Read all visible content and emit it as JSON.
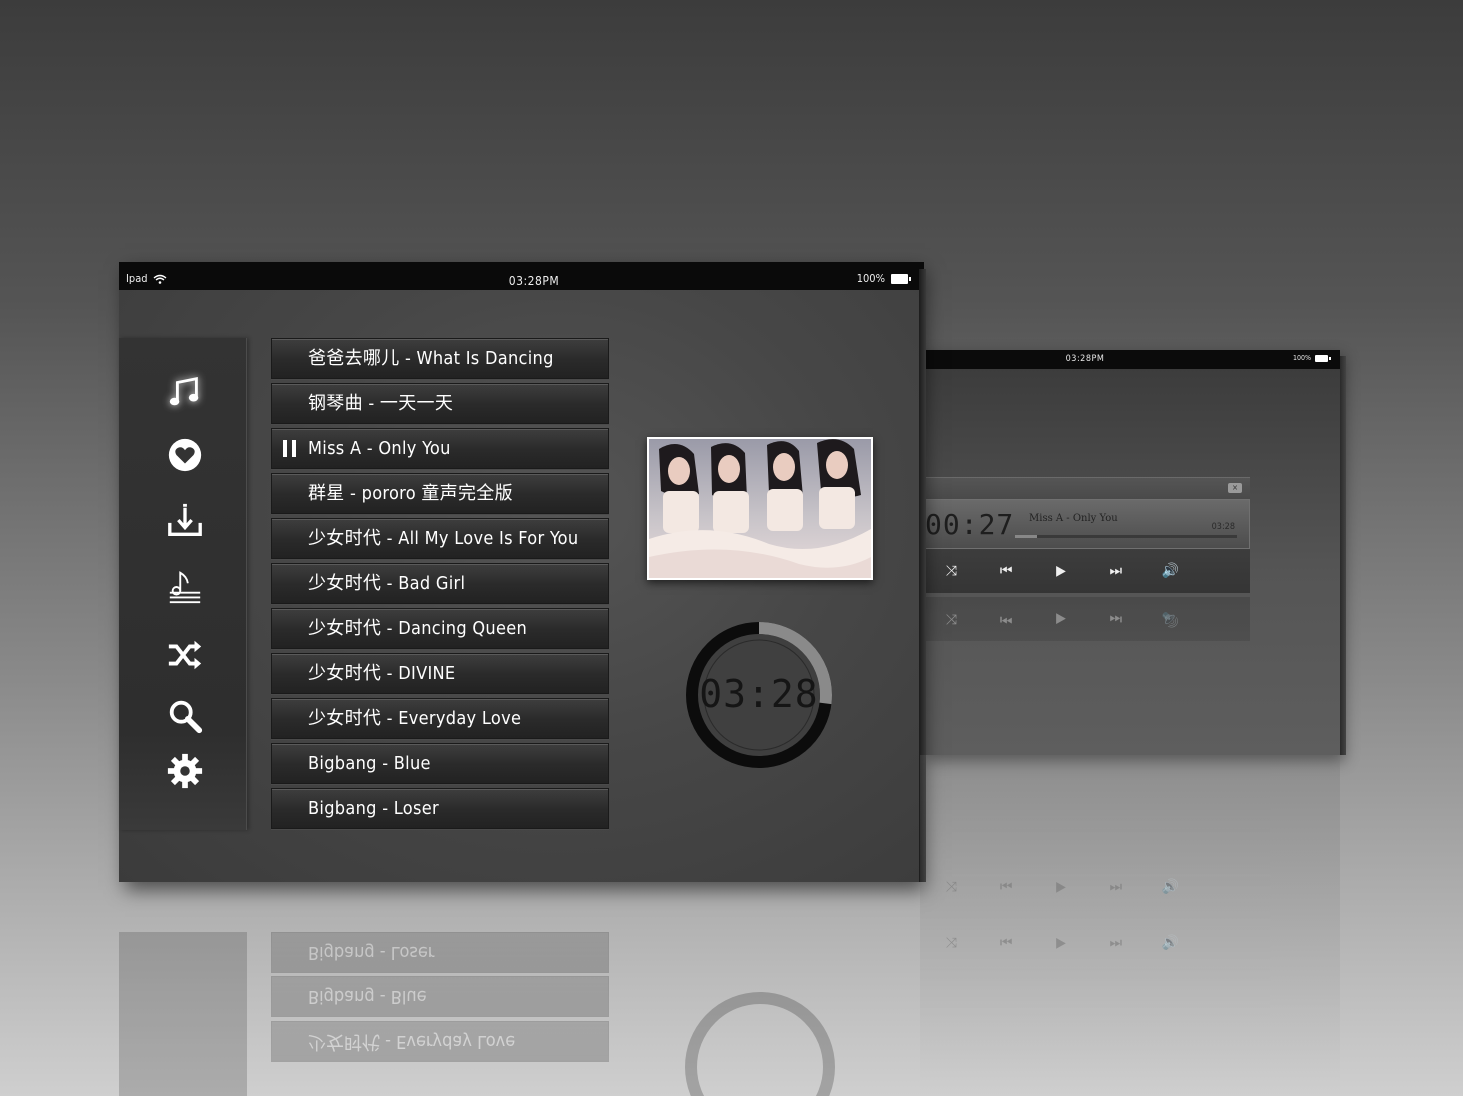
{
  "status_bar": {
    "carrier": "Ipad",
    "time": "03:28PM",
    "battery": "100%"
  },
  "sidebar": {
    "icons": [
      "music-note-icon",
      "heart-icon",
      "download-icon",
      "sheet-music-icon",
      "shuffle-icon",
      "search-icon",
      "gear-icon"
    ]
  },
  "songs": [
    "爸爸去哪儿 - What Is Dancing",
    "钢琴曲 - 一天一天",
    "Miss A - Only You",
    "群星 - pororo 童声完全版",
    "少女时代 - All My Love Is For You",
    "少女时代 - Bad Girl",
    "少女时代 - Dancing Queen",
    "少女时代 - DIVINE",
    "少女时代 - Everyday Love",
    "Bigbang - Blue",
    "Bigbang - Loser"
  ],
  "now_playing_index": 2,
  "timer": {
    "display": "03:28",
    "progress_fraction": 0.27
  },
  "mini_player": {
    "time_label": "03:28PM",
    "battery": "100%",
    "elapsed": "00:27",
    "title": "Miss A - Only You",
    "duration": "03:28",
    "progress_fraction": 0.1,
    "controls": [
      "shuffle-icon",
      "previous-icon",
      "play-icon",
      "next-icon",
      "volume-icon"
    ],
    "close_label": "×"
  },
  "colors": {
    "panel": "#474747",
    "status_bar": "#0a0a0a",
    "timer_ring": "#0c0c0c",
    "timer_progress": "#8a8a8a"
  }
}
